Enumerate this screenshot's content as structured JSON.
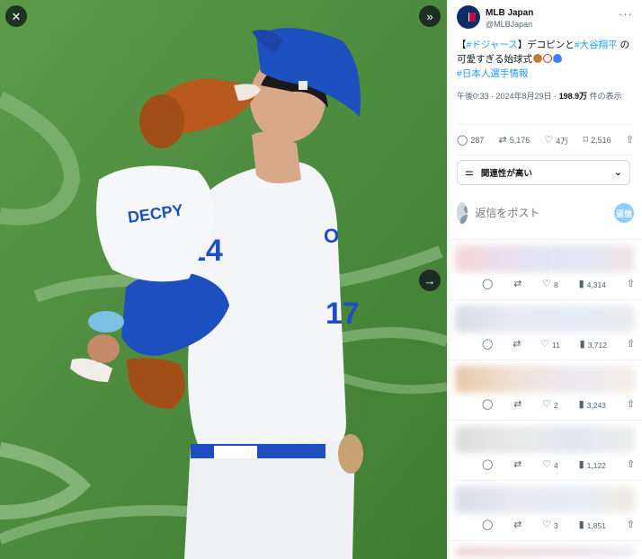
{
  "photo_controls": {
    "close_icon": "close-icon",
    "expand_icon": "double-chevron-right-icon",
    "next_icon": "arrow-right-icon"
  },
  "jersey": {
    "name": "DECPY",
    "number": "17",
    "player_name_partial": "O",
    "player_number": "14"
  },
  "account": {
    "name": "MLB Japan",
    "handle": "@MLBJapan"
  },
  "tweet": {
    "hashtag1": "#ドジャース",
    "text1": "デコピンと",
    "hashtag2": "#大谷翔平",
    "text2": "の可愛すぎる始球式",
    "hashtag3": "#日本人選手情報"
  },
  "meta": {
    "time": "午後0:33 · 2024年8月29日 · ",
    "views": "198.9万",
    "views_suffix": " 件の表示"
  },
  "actions": {
    "replies": "287",
    "reposts": "5,176",
    "likes": "4万",
    "bookmarks": "2,516"
  },
  "sort": {
    "label": "関連性が高い"
  },
  "reply_box": {
    "placeholder": "返信をポスト",
    "button": "返信"
  },
  "replies": [
    {
      "likes": "8",
      "views": "4,314"
    },
    {
      "likes": "11",
      "views": "3,712"
    },
    {
      "likes": "2",
      "views": "3,243"
    },
    {
      "likes": "4",
      "views": "1,122"
    },
    {
      "likes": "3",
      "views": "1,851"
    }
  ],
  "colors": {
    "accent": "#1d9bf0",
    "field": "#4b8c3d",
    "dodger_blue": "#1e4fbf"
  }
}
